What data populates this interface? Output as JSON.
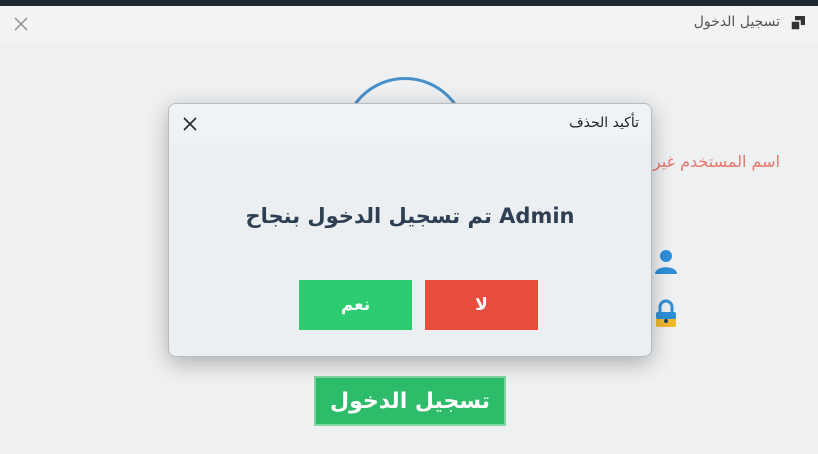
{
  "window": {
    "title": "تسجيل الدخول"
  },
  "login_form": {
    "error_text": "اسم المستخدم غير",
    "login_button_label": "تسجيل الدخول"
  },
  "dialog": {
    "title": "تأكيد الحذف",
    "message": "Admin تم تسجيل الدخول بنجاح",
    "yes_label": "نعم",
    "no_label": "لا"
  },
  "colors": {
    "yes_button": "#2ecc71",
    "no_button": "#e74c3c",
    "login_button": "#2dbd6a",
    "error_text": "#e8776d",
    "accent_blue": "#4a90c8"
  },
  "icons": [
    "close-icon",
    "app-window-icon",
    "user-icon",
    "lock-icon"
  ]
}
